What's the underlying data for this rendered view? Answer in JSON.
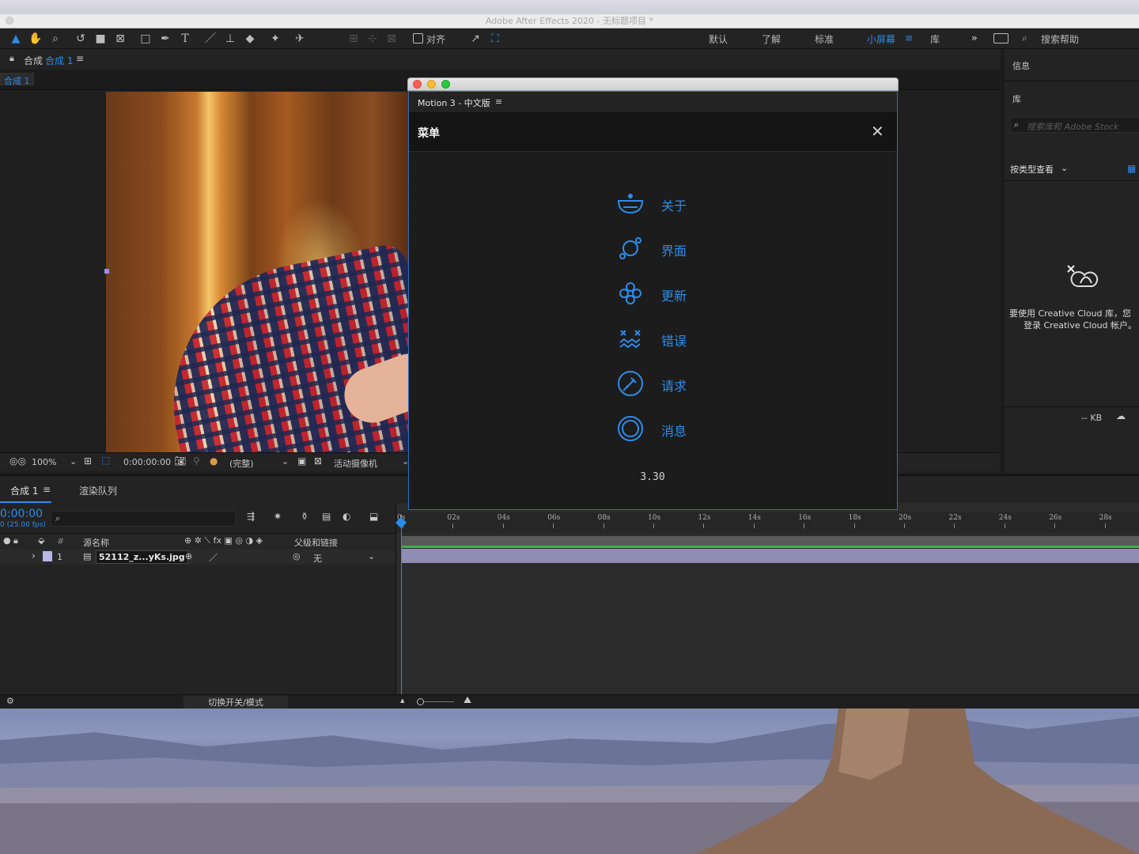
{
  "window": {
    "title": "Adobe After Effects 2020 - 无标题项目 *"
  },
  "toolbar": {
    "align_label": "对齐",
    "workspaces": [
      "默认",
      "了解",
      "标准",
      "小屏幕",
      "库"
    ],
    "active_workspace": "小屏幕",
    "search_help": "搜索帮助"
  },
  "comp_panel": {
    "tab_prefix": "合成",
    "tab_name": "合成 1",
    "sub_tab": "合成 1",
    "viewer": {
      "zoom": "100%",
      "timecode": "0:00:00:00",
      "resolution": "(完整)",
      "camera": "活动摄像机"
    }
  },
  "right_panel": {
    "info_title": "信息",
    "library_title": "库",
    "search_placeholder": "搜索库和 Adobe Stock",
    "view_by": "按类型查看",
    "message_line1": "要使用 Creative Cloud 库，您",
    "message_line2": "登录 Creative Cloud 帐户。",
    "size_label": "-- KB"
  },
  "timeline": {
    "tab_comp": "合成 1",
    "tab_render": "渲染队列",
    "timecode": "0:00:00",
    "fps": "0 (25.00 fps)",
    "headers": {
      "num": "#",
      "source": "源名称",
      "parent": "父级和链接"
    },
    "layer": {
      "num": "1",
      "name": "52112_z...yKs.jpg",
      "parent": "无"
    },
    "ruler": [
      "0s",
      "02s",
      "04s",
      "06s",
      "08s",
      "10s",
      "12s",
      "14s",
      "16s",
      "18s",
      "20s",
      "22s",
      "24s",
      "26s",
      "28s"
    ],
    "footer_toggle": "切换开关/模式"
  },
  "dialog": {
    "tab_title": "Motion 3 - 中文版",
    "header_title": "菜单",
    "accent": "#2d8ceb",
    "items": [
      {
        "icon": "bowl-icon",
        "label": "关于"
      },
      {
        "icon": "planet-icon",
        "label": "界面"
      },
      {
        "icon": "flower-icon",
        "label": "更新"
      },
      {
        "icon": "error-face-icon",
        "label": "错误"
      },
      {
        "icon": "syringe-icon",
        "label": "请求"
      },
      {
        "icon": "ring-icon",
        "label": "消息"
      }
    ],
    "version": "3.30"
  }
}
